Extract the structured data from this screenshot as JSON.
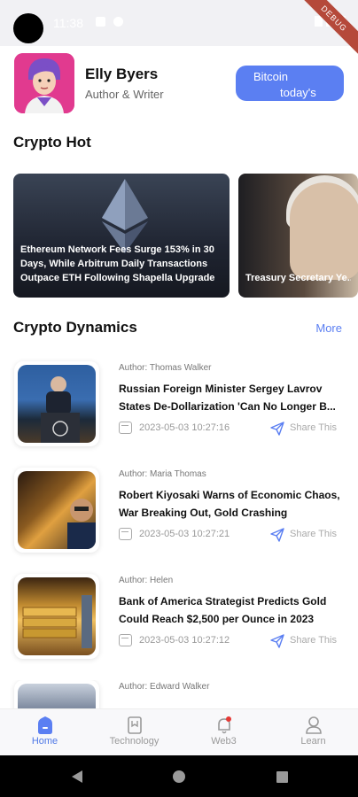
{
  "status_bar": {
    "time": "11:38",
    "ribbon": "DEBUG"
  },
  "profile": {
    "name": "Elly Byers",
    "role": "Author & Writer",
    "price_button": {
      "line1": "Bitcoin",
      "line2": "today's price"
    }
  },
  "hot": {
    "title": "Crypto Hot",
    "cards": [
      {
        "caption": "Ethereum Network Fees Surge 153% in 30 Days, While Arbitrum Daily Transactions Outpace ETH Following Shapella Upgrade"
      },
      {
        "caption": "Treasury Secretary Ye... Default on Its Debt by"
      }
    ]
  },
  "dynamics": {
    "title": "Crypto Dynamics",
    "more_label": "More",
    "share_label": "Share This",
    "articles": [
      {
        "author": "Author: Thomas Walker",
        "headline": "Russian Foreign Minister Sergey Lavrov States De-Dollarization 'Can No Longer B...",
        "date": "2023-05-03 10:27:16"
      },
      {
        "author": "Author: Maria Thomas",
        "headline": "Robert Kiyosaki Warns of Economic Chaos, War Breaking Out, Gold Crashing",
        "date": "2023-05-03 10:27:21"
      },
      {
        "author": "Author: Helen",
        "headline": "Bank of America Strategist Predicts Gold Could Reach $2,500 per Ounce in 2023",
        "date": "2023-05-03 10:27:12"
      },
      {
        "author": "Author: Edward Walker",
        "headline": "",
        "date": ""
      }
    ]
  },
  "bottom_nav": {
    "items": [
      {
        "label": "Home",
        "icon": "home-icon",
        "active": true
      },
      {
        "label": "Technology",
        "icon": "technology-icon",
        "active": false
      },
      {
        "label": "Web3",
        "icon": "web3-bell-icon",
        "active": false
      },
      {
        "label": "Learn",
        "icon": "learn-person-icon",
        "active": false
      }
    ]
  },
  "colors": {
    "accent": "#5b7ff2",
    "nav_active": "#4e78e6",
    "badge": "#e53935"
  }
}
